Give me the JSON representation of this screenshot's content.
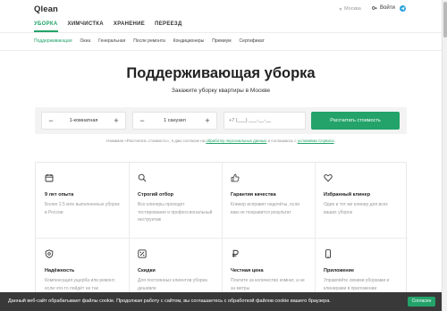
{
  "header": {
    "logo": "Qlean",
    "city": "Москва",
    "login": "Войти",
    "login_icon": "key-icon",
    "messenger_icon": "telegram-icon",
    "accent_color": "#23a36a"
  },
  "categories": [
    {
      "label": "УБОРКА",
      "active": true
    },
    {
      "label": "ХИМЧИСТКА",
      "active": false
    },
    {
      "label": "ХРАНЕНИЕ",
      "active": false
    },
    {
      "label": "ПЕРЕЕЗД",
      "active": false
    }
  ],
  "subnav": [
    {
      "label": "Поддерживающая",
      "active": true
    },
    {
      "label": "Окна",
      "active": false
    },
    {
      "label": "Генеральная",
      "active": false
    },
    {
      "label": "После ремонта",
      "active": false
    },
    {
      "label": "Кондиционеры",
      "active": false
    },
    {
      "label": "Премиум",
      "active": false
    },
    {
      "label": "Сертификат",
      "active": false
    }
  ],
  "hero": {
    "title": "Поддерживающая уборка",
    "subtitle": "Закажите уборку квартиры в Москве"
  },
  "form": {
    "rooms_value": "1-комнатная",
    "baths_value": "1 санузел",
    "minus": "−",
    "plus": "+",
    "phone_placeholder": "+7 (___) ___-__-__",
    "submit_label": "Рассчитать стоимость"
  },
  "consent": {
    "prefix": "Нажимая «Рассчитать стоимость», я даю согласие на ",
    "link1": "обработку персональных данных",
    "middle": " и соглашаюсь с ",
    "link2": "условиями Сервиса",
    "suffix": "."
  },
  "features": [
    {
      "icon": "calendar-icon",
      "title": "9 лет опыта",
      "desc": "Более 2.5 млн выполненных уборок в России"
    },
    {
      "icon": "magnifier-icon",
      "title": "Строгий отбор",
      "desc": "Все клинеры проходят тестирование и профессиональный инструктаж"
    },
    {
      "icon": "thumbs-up-icon",
      "title": "Гарантия качества",
      "desc": "Клинер исправит недочёты, если вам не понравится результат"
    },
    {
      "icon": "heart-icon",
      "title": "Избранный клинер",
      "desc": "Один и тот же клинер для всех ваших уборок"
    },
    {
      "icon": "shield-icon",
      "title": "Надёжность",
      "desc": "Компенсация ущерба или ремонт, если что-то пойдёт не так"
    },
    {
      "icon": "percent-icon",
      "title": "Скидки",
      "desc": "Для постоянных клиентов уборка дешевле"
    },
    {
      "icon": "ruble-icon",
      "title": "Честная цена",
      "desc": "Платите за количество комнат, а не за метры"
    },
    {
      "icon": "phone-icon",
      "title": "Приложение",
      "desc": "Управляйте своими уборками и клинерами в приложении"
    }
  ],
  "cookie": {
    "text": "Данный веб-сайт обрабатывает файлы cookie. Продолжая работу с сайтом, вы соглашаетесь с обработкой файлов cookie вашего браузера.",
    "accept": "Согласен"
  }
}
